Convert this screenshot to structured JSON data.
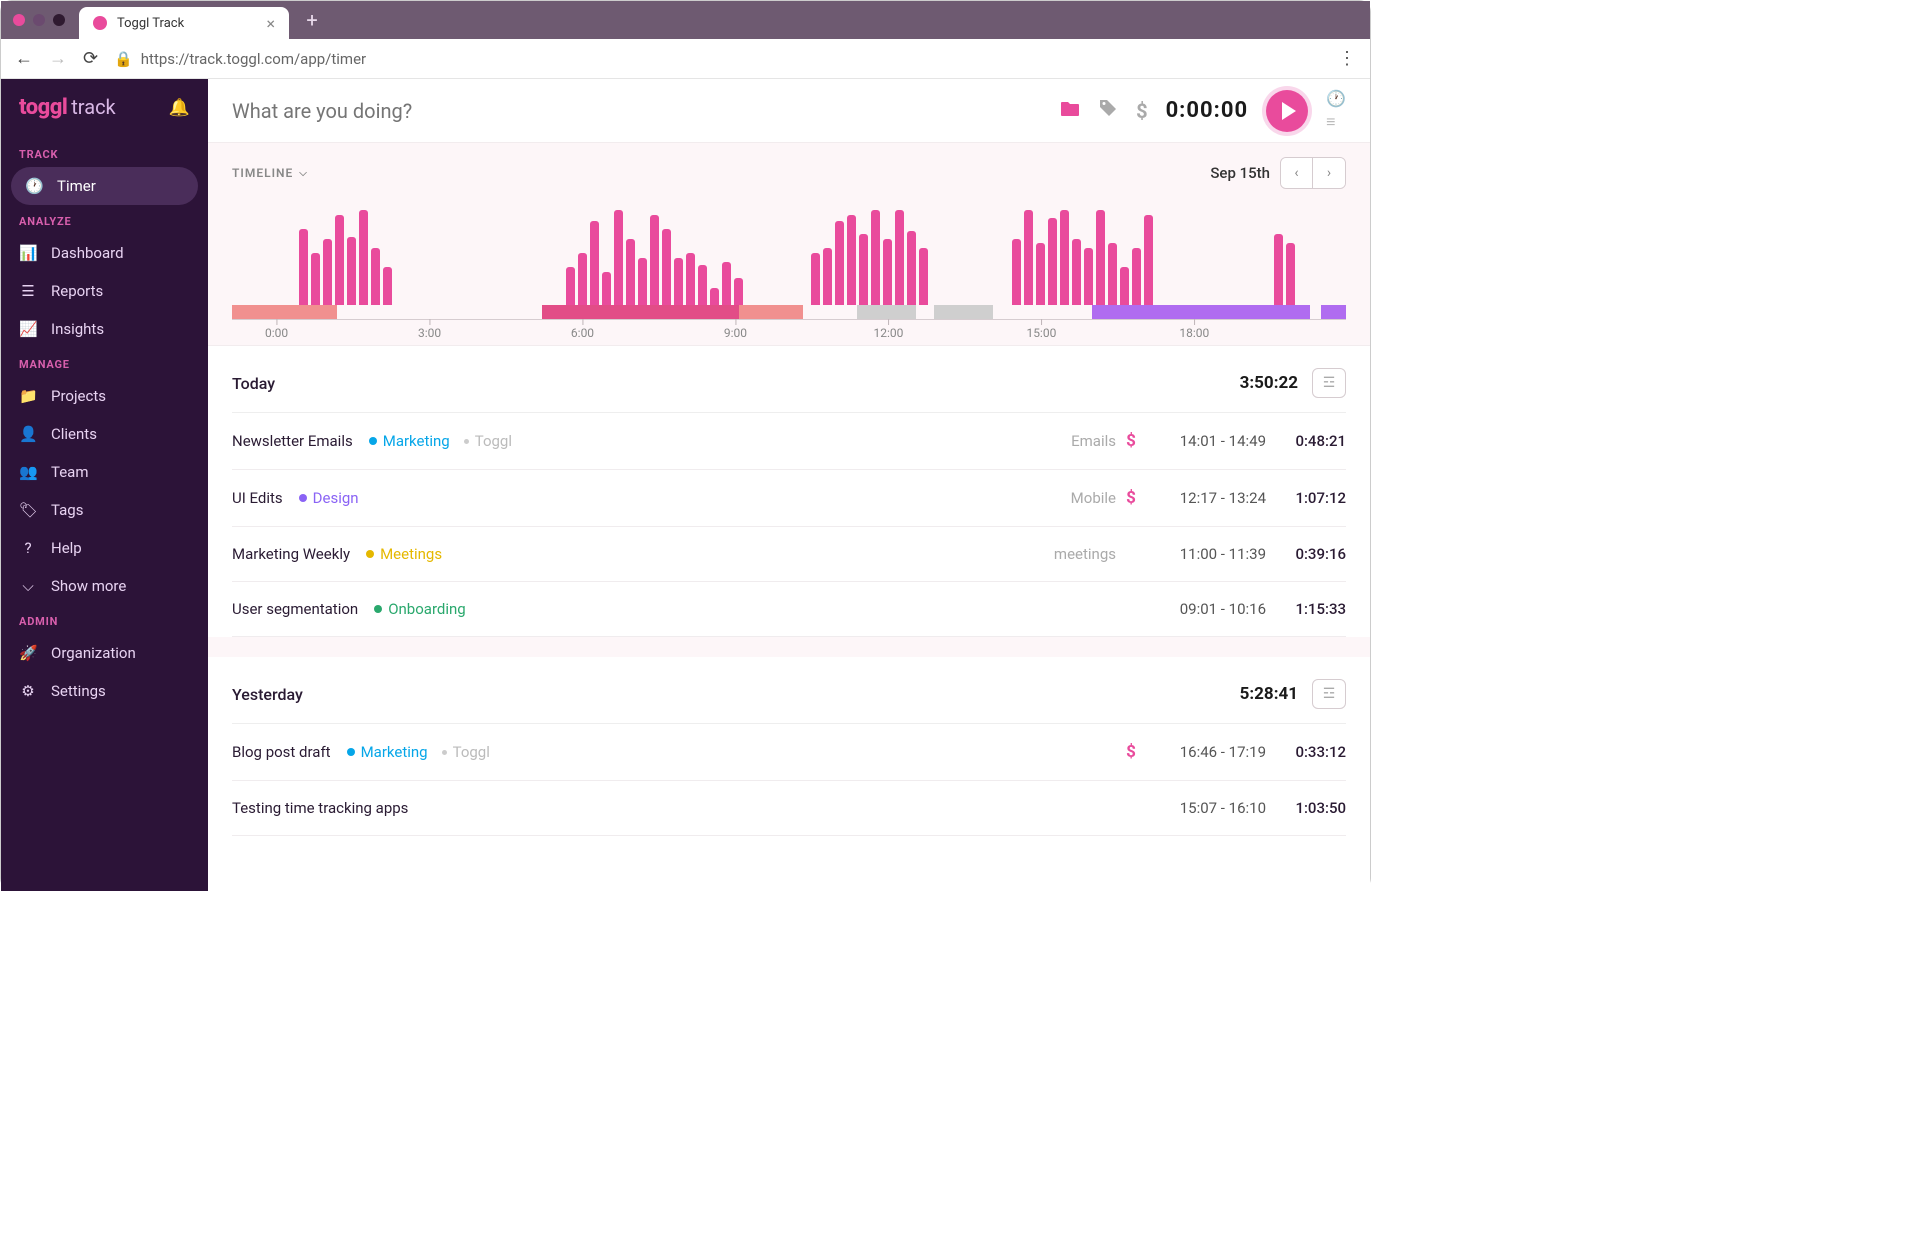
{
  "browser": {
    "tab_title": "Toggl Track",
    "url": "https://track.toggl.com/app/timer"
  },
  "sidebar": {
    "logo_brand": "toggl",
    "logo_product": "track",
    "sections": [
      {
        "label": "TRACK",
        "items": [
          {
            "icon": "clock-icon",
            "label": "Timer",
            "active": true
          }
        ]
      },
      {
        "label": "ANALYZE",
        "items": [
          {
            "icon": "bars-icon",
            "label": "Dashboard"
          },
          {
            "icon": "report-icon",
            "label": "Reports"
          },
          {
            "icon": "insights-icon",
            "label": "Insights"
          }
        ]
      },
      {
        "label": "MANAGE",
        "items": [
          {
            "icon": "folder-icon",
            "label": "Projects"
          },
          {
            "icon": "user-icon",
            "label": "Clients"
          },
          {
            "icon": "team-icon",
            "label": "Team"
          },
          {
            "icon": "tag-icon",
            "label": "Tags"
          },
          {
            "icon": "help-icon",
            "label": "Help"
          },
          {
            "icon": "chevron-down-icon",
            "label": "Show more"
          }
        ]
      },
      {
        "label": "ADMIN",
        "items": [
          {
            "icon": "rocket-icon",
            "label": "Organization"
          },
          {
            "icon": "gear-icon",
            "label": "Settings"
          }
        ]
      }
    ]
  },
  "timer_bar": {
    "placeholder": "What are you doing?",
    "time": "0:00:00"
  },
  "timeline": {
    "title": "TIMELINE",
    "date": "Sep 15th",
    "ticks": [
      "0:00",
      "3:00",
      "6:00",
      "9:00",
      "12:00",
      "15:00",
      "18:00"
    ]
  },
  "chart_data": {
    "type": "bar",
    "title": "TIMELINE",
    "xlabel": "",
    "ylabel": "",
    "x_hours_range": [
      0,
      20
    ],
    "bars_relative_height_percent": [
      80,
      55,
      70,
      95,
      72,
      100,
      60,
      40,
      40,
      55,
      88,
      35,
      100,
      70,
      50,
      95,
      80,
      50,
      55,
      42,
      18,
      45,
      28,
      55,
      60,
      88,
      95,
      75,
      100,
      70,
      100,
      78,
      60,
      70,
      100,
      65,
      92,
      100,
      70,
      60,
      100,
      65,
      40,
      60,
      95,
      75,
      65
    ],
    "track_segments": [
      {
        "start_pct": 0,
        "width_pct": 9.4,
        "color": "#f1908f"
      },
      {
        "start_pct": 9.4,
        "width_pct": 18.4,
        "color": "#fdf6f8"
      },
      {
        "start_pct": 27.8,
        "width_pct": 17.7,
        "color": "#e24d87"
      },
      {
        "start_pct": 45.5,
        "width_pct": 5.8,
        "color": "#f1908f"
      },
      {
        "start_pct": 51.3,
        "width_pct": 4.8,
        "color": "#fdf6f8"
      },
      {
        "start_pct": 56.1,
        "width_pct": 5.3,
        "color": "#cfcfcf"
      },
      {
        "start_pct": 61.4,
        "width_pct": 1.6,
        "color": "#fdf6f8"
      },
      {
        "start_pct": 63.0,
        "width_pct": 5.3,
        "color": "#cfcfcf"
      },
      {
        "start_pct": 68.3,
        "width_pct": 8.9,
        "color": "#fdf6f8"
      },
      {
        "start_pct": 77.2,
        "width_pct": 19.6,
        "color": "#b06cf0"
      },
      {
        "start_pct": 96.8,
        "width_pct": 1.0,
        "color": "#fdf6f8"
      },
      {
        "start_pct": 97.8,
        "width_pct": 2.2,
        "color": "#b06cf0"
      }
    ],
    "bar_clusters_start_pct": [
      6,
      30,
      52,
      70,
      93.5
    ]
  },
  "days": [
    {
      "label": "Today",
      "total": "3:50:22",
      "entries": [
        {
          "desc": "Newsletter Emails",
          "project": "Marketing",
          "pcolor": "#06a6e8",
          "client": "Toggl",
          "tag": "Emails",
          "billable": true,
          "range": "14:01 - 14:49",
          "dur": "0:48:21"
        },
        {
          "desc": "UI Edits",
          "project": "Design",
          "pcolor": "#8a63f5",
          "client": "",
          "tag": "Mobile",
          "billable": true,
          "range": "12:17 - 13:24",
          "dur": "1:07:12"
        },
        {
          "desc": "Marketing Weekly",
          "project": "Meetings",
          "pcolor": "#e5b800",
          "client": "",
          "tag": "meetings",
          "billable": false,
          "range": "11:00 - 11:39",
          "dur": "0:39:16"
        },
        {
          "desc": "User segmentation",
          "project": "Onboarding",
          "pcolor": "#2aa86d",
          "client": "",
          "tag": "",
          "billable": false,
          "range": "09:01 - 10:16",
          "dur": "1:15:33"
        }
      ]
    },
    {
      "label": "Yesterday",
      "total": "5:28:41",
      "entries": [
        {
          "desc": "Blog post draft",
          "project": "Marketing",
          "pcolor": "#06a6e8",
          "client": "Toggl",
          "tag": "",
          "billable": true,
          "range": "16:46 - 17:19",
          "dur": "0:33:12"
        },
        {
          "desc": "Testing time tracking apps",
          "project": "",
          "pcolor": "",
          "client": "",
          "tag": "",
          "billable": false,
          "range": "15:07 - 16:10",
          "dur": "1:03:50"
        }
      ]
    }
  ]
}
